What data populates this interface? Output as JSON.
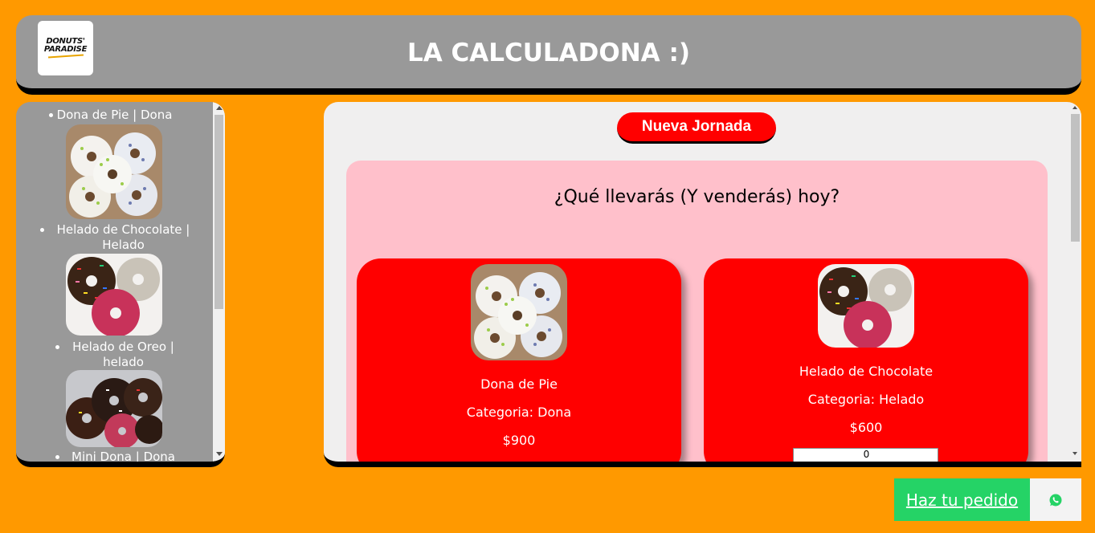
{
  "header": {
    "logo_line1": "DONUTS'",
    "logo_line2": "PARADISE",
    "title": "LA CALCULADONA :)"
  },
  "sidebar": {
    "items": [
      {
        "label": "Dona de Pie | Dona"
      },
      {
        "label": "Helado de Chocolate | Helado"
      },
      {
        "label": "Helado de Oreo | helado"
      },
      {
        "label": "Mini Dona | Dona"
      }
    ]
  },
  "main": {
    "new_day_button": "Nueva Jornada",
    "question": "¿Qué llevarás (Y venderás) hoy?",
    "cards": [
      {
        "name": "Dona de Pie",
        "category": "Categoria: Dona",
        "price": "$900"
      },
      {
        "name": "Helado de Chocolate",
        "category": "Categoria: Helado",
        "price": "$600",
        "quantity": "0"
      }
    ]
  },
  "whatsapp": {
    "label": "Haz tu pedido"
  },
  "colors": {
    "background": "#ff9900",
    "panel": "#999999",
    "accent": "#ff0000",
    "pink": "#ffc0cb",
    "whatsapp": "#25d366"
  }
}
